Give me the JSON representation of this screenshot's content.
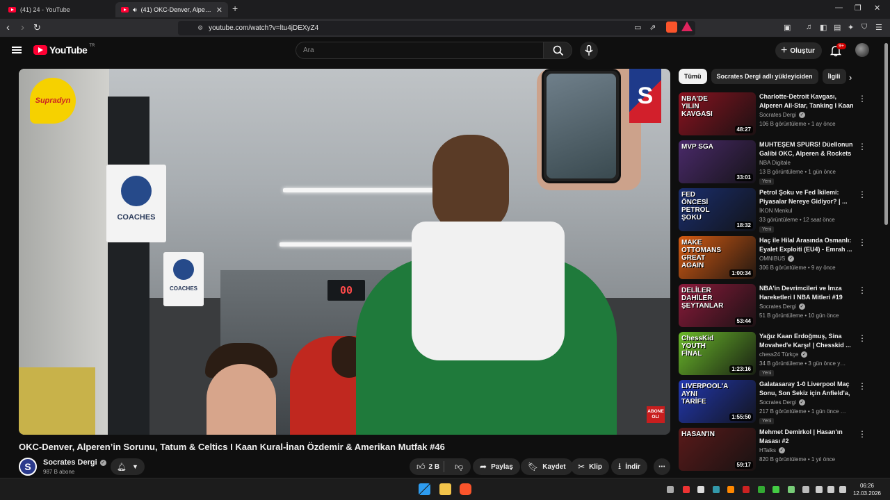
{
  "browser": {
    "tabs": [
      {
        "title": "(41) 24 - YouTube"
      },
      {
        "title": "(41) OKC-Denver, Alperen'in Sorunu"
      }
    ],
    "url": "youtube.com/watch?v=ltu4jDEXyZ4"
  },
  "header": {
    "logo_text": "YouTube",
    "logo_country": "TR",
    "search_placeholder": "Ara",
    "create_label": "Oluştur",
    "notifications_badge": "9+"
  },
  "video": {
    "title": "OKC-Denver, Alperen’in Sorunu, Tatum & Celtics I Kaan Kural-İnan Özdemir & Amerikan Mutfak #46",
    "overlay": {
      "sponsor_logo": "Supradyn",
      "channel_logo": "S",
      "coaches_sign": "COACHES",
      "scoreboard": "00",
      "subscribe_badge": "ABONE OL!"
    }
  },
  "channel": {
    "name": "Socrates Dergi",
    "avatar_letter": "S",
    "subscribers": "987 B abone"
  },
  "actions": {
    "likes": "2 B",
    "share": "Paylaş",
    "save": "Kaydet",
    "clip": "Klip",
    "download": "İndir"
  },
  "chips": [
    "Tümü",
    "Socrates Dergi adlı yükleyiciden",
    "İlgili"
  ],
  "recommendations": [
    {
      "title": "Charlotte-Detroit Kavgası, Alperen All-Star, Tanking I Kaan Kural & İnan Özdemir",
      "channel": "Socrates Dergi",
      "verified": true,
      "meta": "106 B görüntüleme • 1 ay önce",
      "duration": "48:27",
      "badge": "",
      "thumb_text": "NBA'DE YILIN KAVGASI",
      "thumb_color": "#8a1220"
    },
    {
      "title": "MUHTEŞEM SPURS! Düellonun Galibi OKC, Alperen & Rockets ...",
      "channel": "NBA Digitale",
      "verified": false,
      "meta": "13 B görüntüleme • 1 gün önce",
      "duration": "33:01",
      "badge": "Yeni",
      "thumb_text": "MVP SGA",
      "thumb_color": "#4a2a6a"
    },
    {
      "title": "Petrol Şoku ve Fed İkilemi: Piyasalar Nereye Gidiyor? | ...",
      "channel": "İKON Menkul",
      "verified": false,
      "meta": "33 görüntüleme • 12 saat önce",
      "duration": "18:32",
      "badge": "Yeni",
      "thumb_text": "FED ÖNCESİ PETROL ŞOKU",
      "thumb_color": "#1a2e6e"
    },
    {
      "title": "Haç ile Hilal Arasında Osmanlı: Eyalet Exploiti (EU4) - Emrah ...",
      "channel": "OMNIBUS",
      "verified": true,
      "meta": "306 B görüntüleme • 9 ay önce",
      "duration": "1:00:34",
      "badge": "",
      "thumb_text": "MAKE OTTOMANS GREAT AGAIN",
      "thumb_color": "#d25a12"
    },
    {
      "title": "NBA'in Devrimcileri ve İmza Hareketleri I NBA Mitleri #19",
      "channel": "Socrates Dergi",
      "verified": true,
      "meta": "51 B görüntüleme • 10 gün önce",
      "duration": "53:44",
      "badge": "",
      "thumb_text": "DELİLER DAHİLER ŞEYTANLAR",
      "thumb_color": "#8a1a3a"
    },
    {
      "title": "Yağız Kaan Erdoğmuş, Sina Movahed'e Karşı! | Chesskid ...",
      "channel": "chess24 Türkçe",
      "verified": true,
      "meta": "34 B görüntüleme • 3 gün önce yayınlandı",
      "duration": "1:23:16",
      "badge": "Yeni",
      "thumb_text": "ChessKid YOUTH FİNAL",
      "thumb_color": "#6ab82a"
    },
    {
      "title": "Galatasaray 1-0 Liverpool Maç Sonu, Son Sekiz için Anfield'a, ...",
      "channel": "Socrates Dergi",
      "verified": true,
      "meta": "217 B görüntüleme • 1 gün önce yayınlandı",
      "duration": "1:55:50",
      "badge": "Yeni",
      "thumb_text": "LIVERPOOL'A AYNI TARİFE",
      "thumb_color": "#2238b0"
    },
    {
      "title": "Mehmet Demirkol | Hasan'ın Masası #2",
      "channel": "HTalks",
      "verified": true,
      "meta": "820 B görüntüleme • 1 yıl önce",
      "duration": "59:17",
      "badge": "",
      "thumb_text": "HASAN'IN",
      "thumb_color": "#5a1a1a"
    }
  ],
  "taskbar": {
    "time": "06:26",
    "date": "12.03.2026"
  },
  "colors": {
    "background": "#0f0f0f",
    "youtube_red": "#ff0033",
    "pill": "#272727"
  }
}
